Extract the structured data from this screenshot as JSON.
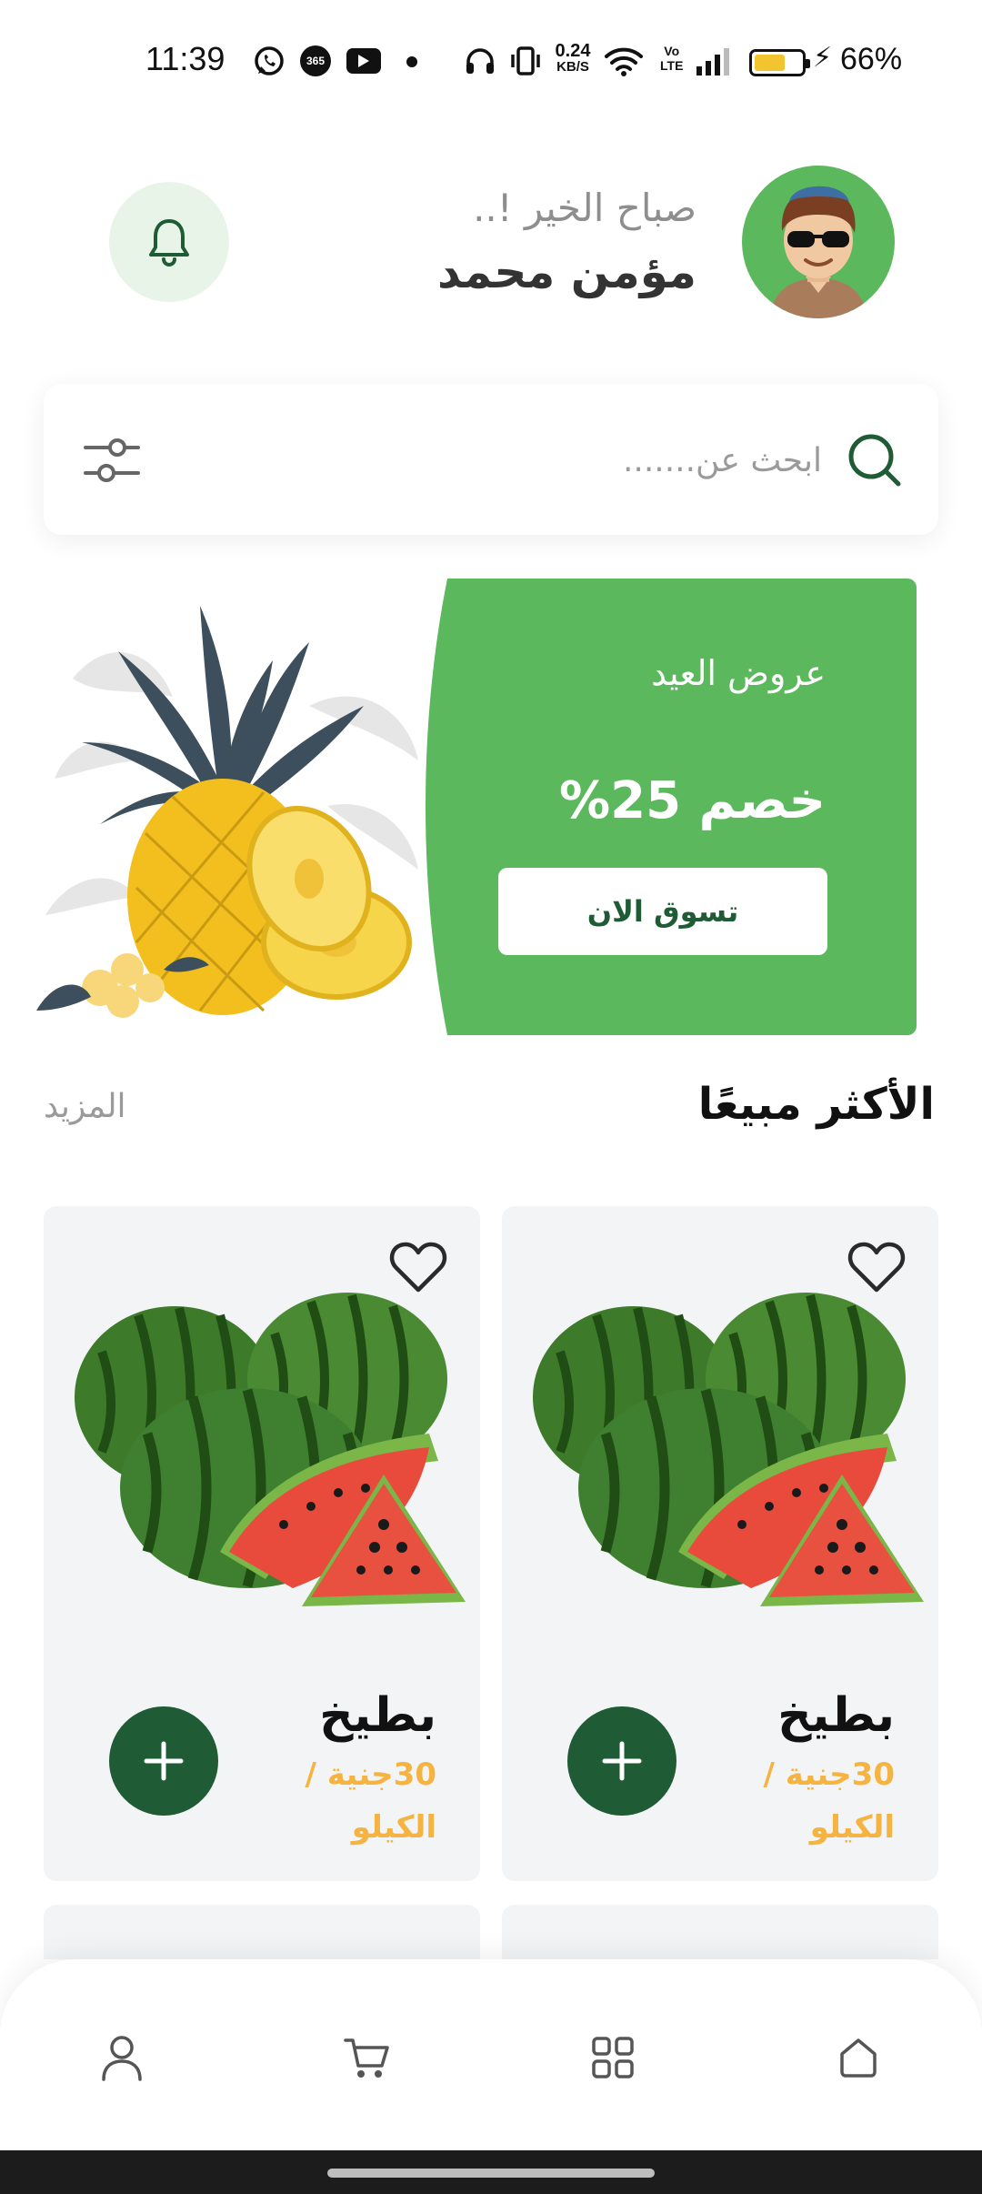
{
  "status_bar": {
    "time": "11:39",
    "app_badge": "365",
    "net_speed_value": "0.24",
    "net_speed_unit": "KB/S",
    "network_label_top": "Vo",
    "network_label_bottom": "LTE",
    "battery_percent": "66%",
    "battery_level": 0.66,
    "icons": [
      "whatsapp-icon",
      "app-365-icon",
      "youtube-icon",
      "dot-icon",
      "headphones-icon",
      "vibrate-icon",
      "wifi-icon",
      "volte-icon",
      "signal-icon",
      "battery-icon",
      "charging-icon"
    ]
  },
  "header": {
    "greeting": "صباح الخير !..",
    "user_name": "مؤمن محمد",
    "notification_icon": "bell-icon",
    "avatar_icon": "avatar-icon"
  },
  "search": {
    "placeholder": "ابحث عن.......",
    "value": "",
    "search_icon": "search-icon",
    "filter_icon": "filter-icon"
  },
  "banner": {
    "subtitle": "عروض العيد",
    "title": "خصم 25%",
    "button_label": "تسوق الان",
    "image": "pineapple-image"
  },
  "best_sellers": {
    "title": "الأكثر مبيعًا",
    "more_label": "المزيد",
    "products": [
      {
        "name": "بطيخ",
        "price": "30جنية / الكيلو",
        "image": "watermelon-image"
      },
      {
        "name": "بطيخ",
        "price": "30جنية / الكيلو",
        "image": "watermelon-image"
      }
    ]
  },
  "bottom_nav": {
    "items": [
      {
        "icon": "home-icon"
      },
      {
        "icon": "categories-icon"
      },
      {
        "icon": "cart-icon"
      },
      {
        "icon": "profile-icon"
      }
    ]
  },
  "colors": {
    "primary_green": "#1f5c36",
    "banner_green": "#5cb85c",
    "price_orange": "#f5b342",
    "card_bg": "#f3f4f6",
    "bell_bg": "#e9f4e9"
  }
}
